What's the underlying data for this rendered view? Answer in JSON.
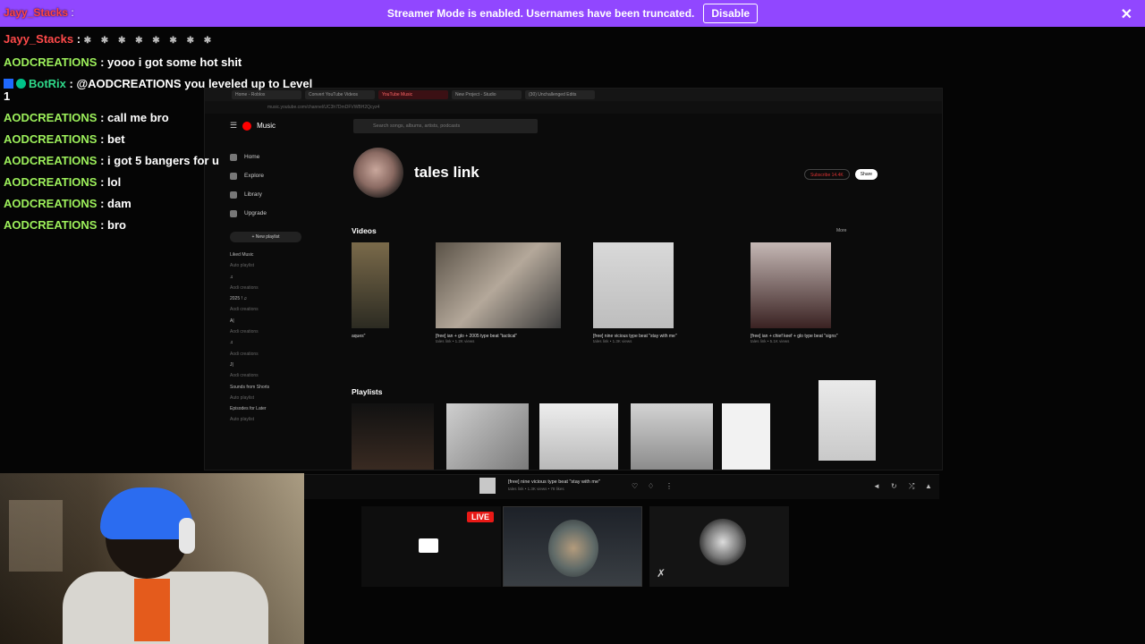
{
  "banner": {
    "overlap_user": "Jayy_Stacks",
    "overlap_sep": " : ",
    "message": "Streamer Mode is enabled. Usernames have been truncated.",
    "disable_label": "Disable",
    "close_icon": "close-icon",
    "color": "#9147ff"
  },
  "chat": {
    "messages": [
      {
        "user": "Jayy_Stacks",
        "text": " : ",
        "emotes": "✱ ✱ ✱ ✱ ✱ ✱ ✱ ✱"
      },
      {
        "user": "AODCREATIONS",
        "text": " : yooo i got some hot shit"
      },
      {
        "user": "BotRix",
        "text": " : @AODCREATIONS you leveled up to Level"
      },
      {
        "user": "",
        "text": "1"
      },
      {
        "user": "AODCREATIONS",
        "text": " : call me bro"
      },
      {
        "user": "AODCREATIONS",
        "text": " : bet"
      },
      {
        "user": "AODCREATIONS",
        "text": " : i got 5 bangers for u"
      },
      {
        "user": "AODCREATIONS",
        "text": " : lol"
      },
      {
        "user": "AODCREATIONS",
        "text": " : dam"
      },
      {
        "user": "AODCREATIONS",
        "text": " : bro"
      }
    ]
  },
  "browser": {
    "tabs": [
      "Home - Roblox",
      "Convert YouTube Videos",
      "YouTube Music",
      "New Project - Studio",
      "(30) Unchallenged Edits"
    ],
    "url": "music.youtube.com/channel/UC3h7DmDFVWBH2Qcyz4",
    "app_name": "Music",
    "search_placeholder": "Search songs, albums, artists, podcasts",
    "nav": [
      "Home",
      "Explore",
      "Library",
      "Upgrade"
    ],
    "new_playlist": "+ New playlist",
    "library": [
      {
        "title": "Liked Music",
        "sub": "Auto playlist"
      },
      {
        "title": "♫",
        "sub": "Aodi creations"
      },
      {
        "title": "2025 ! ♫",
        "sub": "Aodi creations"
      },
      {
        "title": "A|",
        "sub": "Aodi creations"
      },
      {
        "title": "♫",
        "sub": "Aodi creations"
      },
      {
        "title": "J|",
        "sub": "Aodi creations"
      },
      {
        "title": "Sounds from Shorts",
        "sub": "Auto playlist"
      },
      {
        "title": "Episodes for Later",
        "sub": "Auto playlist"
      }
    ],
    "artist_name": "tales link",
    "subscribe_label": "Subscribe 14.4K",
    "share_label": "Share",
    "videos_title": "Videos",
    "more_label": "More",
    "videos": [
      {
        "title": "aques\"",
        "stats": ""
      },
      {
        "title": "[free] ian + glo + 2005 type beat \"tactical\"",
        "stats": "tales link • 1.2K views"
      },
      {
        "title": "[free] nine vicious type beat \"stay with me\"",
        "stats": "tales link • 1.3K views"
      },
      {
        "title": "[free] ian + chief keef + glo type beat \"signs\"",
        "stats": "tales link • 5.1K views"
      }
    ],
    "playlists_title": "Playlists"
  },
  "player": {
    "title": "[free] nine vicious type beat \"stay with me\"",
    "subtitle": "tales link • 1.3K views • 78 likes"
  },
  "call": {
    "live_label": "LIVE"
  }
}
